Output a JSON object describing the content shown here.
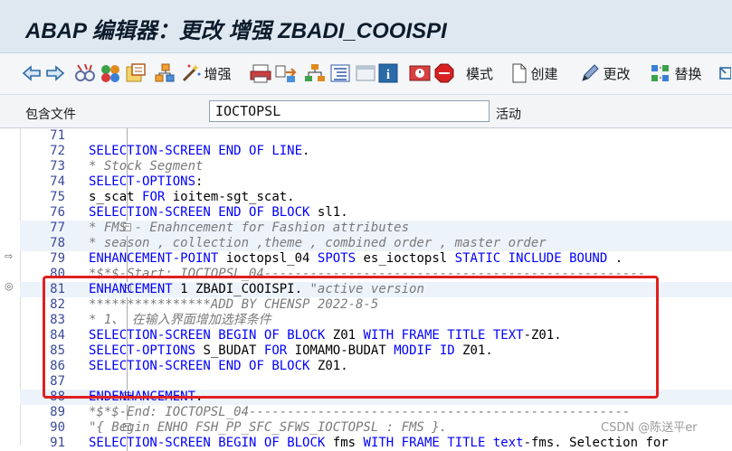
{
  "window": {
    "title": "ABAP 编辑器：更改 增强 ZBADI_COOISPI"
  },
  "toolbar": {
    "enhance_label": "增强",
    "mode_label": "模式",
    "create_label": "创建",
    "change_label": "更改",
    "replace_label": "替换"
  },
  "include": {
    "label": "包含文件",
    "value": "IOCTOPSL",
    "status": "活动"
  },
  "code": {
    "lines": [
      {
        "no": "71",
        "text": ""
      },
      {
        "no": "72",
        "text": "  SELECTION-SCREEN END   OF LINE."
      },
      {
        "no": "73",
        "text": "* Stock Segment"
      },
      {
        "no": "74",
        "text": "  SELECT-OPTIONS:"
      },
      {
        "no": "75",
        "text": "    s_scat   FOR ioitem-sgt_scat."
      },
      {
        "no": "76",
        "text": "  SELECTION-SCREEN END   OF BLOCK sl1."
      },
      {
        "no": "77",
        "text": "* FMS - Enahncement for Fashion attributes"
      },
      {
        "no": "78",
        "text": "* season , collection ,theme , combined order , master order"
      },
      {
        "no": "79",
        "text": "ENHANCEMENT-POINT ioctopsl_04 SPOTS es_ioctopsl STATIC INCLUDE BOUND ."
      },
      {
        "no": "80",
        "text": "*$*$-Start: IOCTOPSL_04--------------------------------------------------"
      },
      {
        "no": "81",
        "text": "ENHANCEMENT 1  ZBADI_COOISPI.    \"active version"
      },
      {
        "no": "82",
        "text": "****************ADD BY CHENSP 2022-8-5"
      },
      {
        "no": "83",
        "text": "*    1、 在输入界面增加选择条件"
      },
      {
        "no": "84",
        "text": "  SELECTION-SCREEN BEGIN OF BLOCK Z01 WITH FRAME TITLE TEXT-Z01."
      },
      {
        "no": "85",
        "text": "    SELECT-OPTIONS S_BUDAT FOR IOMAMO-BUDAT MODIF ID Z01."
      },
      {
        "no": "86",
        "text": "  SELECTION-SCREEN END OF BLOCK Z01."
      },
      {
        "no": "87",
        "text": ""
      },
      {
        "no": "88",
        "text": "ENDENHANCEMENT."
      },
      {
        "no": "89",
        "text": "*$*$-End:   IOCTOPSL_04--------------------------------------------------"
      },
      {
        "no": "90",
        "text": "\"{ Begin ENHO   FSH_PP_SFC_SFWS_IOCTOPSL : FMS }."
      },
      {
        "no": "91",
        "text": "  SELECTION-SCREEN BEGIN OF BLOCK fms WITH FRAME TITLE text-fms.   Selection for"
      }
    ]
  },
  "watermark": "CSDN @陈送平er",
  "colors": {
    "keyword": "#0000ff",
    "comment": "#7a7a7a",
    "highlight_box": "#e02020",
    "line_number": "#3a4a9a"
  },
  "icons": [
    "back-arrow-icon",
    "forward-arrow-icon",
    "glasses-icon",
    "multi-object-icon",
    "object-list-icon",
    "hierarchy-icon",
    "magic-wand-icon",
    "print-icon",
    "where-used-icon",
    "navigation-tree-icon",
    "pretty-printer-icon",
    "window-icon",
    "info-icon",
    "stop-watch-icon",
    "breakpoint-icon",
    "document-icon",
    "pencil-icon",
    "replace-icon",
    "more-icon"
  ]
}
